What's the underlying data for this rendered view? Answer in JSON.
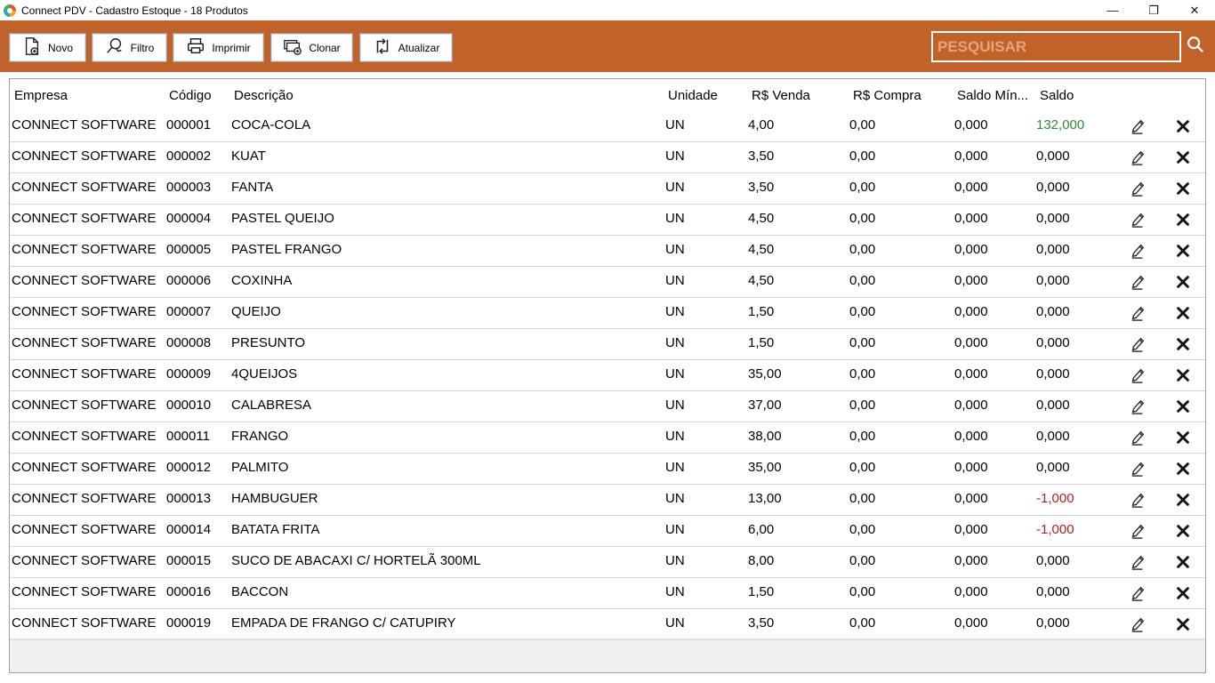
{
  "window": {
    "title": "Connect PDV - Cadastro Estoque - 18 Produtos",
    "minimize": "—",
    "restore": "❐",
    "close": "✕"
  },
  "toolbar": {
    "buttons": [
      {
        "label": "Novo",
        "icon": "new-document-icon"
      },
      {
        "label": "Filtro",
        "icon": "filter-search-icon"
      },
      {
        "label": "Imprimir",
        "icon": "printer-icon"
      },
      {
        "label": "Clonar",
        "icon": "clone-icon"
      },
      {
        "label": "Atualizar",
        "icon": "refresh-icon"
      }
    ],
    "search_placeholder": "PESQUISAR",
    "search_value": ""
  },
  "colors": {
    "toolbar_bg": "#c1622b",
    "positive_balance": "#2e8b2e",
    "negative_balance": "#b22222"
  },
  "table": {
    "columns": [
      "Empresa",
      "Código",
      "Descrição",
      "Unidade",
      "R$ Venda",
      "R$ Compra",
      "Saldo Mín...",
      "Saldo"
    ],
    "rows": [
      {
        "empresa": "CONNECT SOFTWARE",
        "codigo": "000001",
        "descricao": "COCA-COLA",
        "unidade": "UN",
        "venda": "4,00",
        "compra": "0,00",
        "saldo_min": "0,000",
        "saldo": "132,000",
        "saldo_status": "positive"
      },
      {
        "empresa": "CONNECT SOFTWARE",
        "codigo": "000002",
        "descricao": "KUAT",
        "unidade": "UN",
        "venda": "3,50",
        "compra": "0,00",
        "saldo_min": "0,000",
        "saldo": "0,000",
        "saldo_status": "zero"
      },
      {
        "empresa": "CONNECT SOFTWARE",
        "codigo": "000003",
        "descricao": "FANTA",
        "unidade": "UN",
        "venda": "3,50",
        "compra": "0,00",
        "saldo_min": "0,000",
        "saldo": "0,000",
        "saldo_status": "zero"
      },
      {
        "empresa": "CONNECT SOFTWARE",
        "codigo": "000004",
        "descricao": "PASTEL QUEIJO",
        "unidade": "UN",
        "venda": "4,50",
        "compra": "0,00",
        "saldo_min": "0,000",
        "saldo": "0,000",
        "saldo_status": "zero"
      },
      {
        "empresa": "CONNECT SOFTWARE",
        "codigo": "000005",
        "descricao": "PASTEL FRANGO",
        "unidade": "UN",
        "venda": "4,50",
        "compra": "0,00",
        "saldo_min": "0,000",
        "saldo": "0,000",
        "saldo_status": "zero"
      },
      {
        "empresa": "CONNECT SOFTWARE",
        "codigo": "000006",
        "descricao": "COXINHA",
        "unidade": "UN",
        "venda": "4,50",
        "compra": "0,00",
        "saldo_min": "0,000",
        "saldo": "0,000",
        "saldo_status": "zero"
      },
      {
        "empresa": "CONNECT SOFTWARE",
        "codigo": "000007",
        "descricao": "QUEIJO",
        "unidade": "UN",
        "venda": "1,50",
        "compra": "0,00",
        "saldo_min": "0,000",
        "saldo": "0,000",
        "saldo_status": "zero"
      },
      {
        "empresa": "CONNECT SOFTWARE",
        "codigo": "000008",
        "descricao": "PRESUNTO",
        "unidade": "UN",
        "venda": "1,50",
        "compra": "0,00",
        "saldo_min": "0,000",
        "saldo": "0,000",
        "saldo_status": "zero"
      },
      {
        "empresa": "CONNECT SOFTWARE",
        "codigo": "000009",
        "descricao": "4QUEIJOS",
        "unidade": "UN",
        "venda": "35,00",
        "compra": "0,00",
        "saldo_min": "0,000",
        "saldo": "0,000",
        "saldo_status": "zero"
      },
      {
        "empresa": "CONNECT SOFTWARE",
        "codigo": "000010",
        "descricao": "CALABRESA",
        "unidade": "UN",
        "venda": "37,00",
        "compra": "0,00",
        "saldo_min": "0,000",
        "saldo": "0,000",
        "saldo_status": "zero"
      },
      {
        "empresa": "CONNECT SOFTWARE",
        "codigo": "000011",
        "descricao": "FRANGO",
        "unidade": "UN",
        "venda": "38,00",
        "compra": "0,00",
        "saldo_min": "0,000",
        "saldo": "0,000",
        "saldo_status": "zero"
      },
      {
        "empresa": "CONNECT SOFTWARE",
        "codigo": "000012",
        "descricao": "PALMITO",
        "unidade": "UN",
        "venda": "35,00",
        "compra": "0,00",
        "saldo_min": "0,000",
        "saldo": "0,000",
        "saldo_status": "zero"
      },
      {
        "empresa": "CONNECT SOFTWARE",
        "codigo": "000013",
        "descricao": "HAMBUGUER",
        "unidade": "UN",
        "venda": "13,00",
        "compra": "0,00",
        "saldo_min": "0,000",
        "saldo": "-1,000",
        "saldo_status": "negative"
      },
      {
        "empresa": "CONNECT SOFTWARE",
        "codigo": "000014",
        "descricao": "BATATA FRITA",
        "unidade": "UN",
        "venda": "6,00",
        "compra": "0,00",
        "saldo_min": "0,000",
        "saldo": "-1,000",
        "saldo_status": "negative"
      },
      {
        "empresa": "CONNECT SOFTWARE",
        "codigo": "000015",
        "descricao": "SUCO DE ABACAXI C/ HORTELÃ 300ML",
        "unidade": "UN",
        "venda": "8,00",
        "compra": "0,00",
        "saldo_min": "0,000",
        "saldo": "0,000",
        "saldo_status": "zero"
      },
      {
        "empresa": "CONNECT SOFTWARE",
        "codigo": "000016",
        "descricao": "BACCON",
        "unidade": "UN",
        "venda": "1,50",
        "compra": "0,00",
        "saldo_min": "0,000",
        "saldo": "0,000",
        "saldo_status": "zero"
      },
      {
        "empresa": "CONNECT SOFTWARE",
        "codigo": "000019",
        "descricao": "EMPADA DE FRANGO C/ CATUPIRY",
        "unidade": "UN",
        "venda": "3,50",
        "compra": "0,00",
        "saldo_min": "0,000",
        "saldo": "0,000",
        "saldo_status": "zero"
      }
    ],
    "row_actions": [
      {
        "icon": "edit-pencil-icon"
      },
      {
        "icon": "delete-x-icon"
      }
    ]
  }
}
